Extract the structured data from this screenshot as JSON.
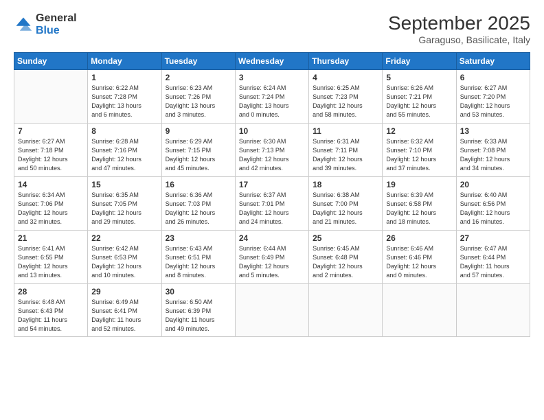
{
  "header": {
    "logo": {
      "general": "General",
      "blue": "Blue"
    },
    "title": "September 2025",
    "location": "Garaguso, Basilicate, Italy"
  },
  "weekdays": [
    "Sunday",
    "Monday",
    "Tuesday",
    "Wednesday",
    "Thursday",
    "Friday",
    "Saturday"
  ],
  "rows": [
    [
      {
        "day": "",
        "info": ""
      },
      {
        "day": "1",
        "info": "Sunrise: 6:22 AM\nSunset: 7:28 PM\nDaylight: 13 hours\nand 6 minutes."
      },
      {
        "day": "2",
        "info": "Sunrise: 6:23 AM\nSunset: 7:26 PM\nDaylight: 13 hours\nand 3 minutes."
      },
      {
        "day": "3",
        "info": "Sunrise: 6:24 AM\nSunset: 7:24 PM\nDaylight: 13 hours\nand 0 minutes."
      },
      {
        "day": "4",
        "info": "Sunrise: 6:25 AM\nSunset: 7:23 PM\nDaylight: 12 hours\nand 58 minutes."
      },
      {
        "day": "5",
        "info": "Sunrise: 6:26 AM\nSunset: 7:21 PM\nDaylight: 12 hours\nand 55 minutes."
      },
      {
        "day": "6",
        "info": "Sunrise: 6:27 AM\nSunset: 7:20 PM\nDaylight: 12 hours\nand 53 minutes."
      }
    ],
    [
      {
        "day": "7",
        "info": "Sunrise: 6:27 AM\nSunset: 7:18 PM\nDaylight: 12 hours\nand 50 minutes."
      },
      {
        "day": "8",
        "info": "Sunrise: 6:28 AM\nSunset: 7:16 PM\nDaylight: 12 hours\nand 47 minutes."
      },
      {
        "day": "9",
        "info": "Sunrise: 6:29 AM\nSunset: 7:15 PM\nDaylight: 12 hours\nand 45 minutes."
      },
      {
        "day": "10",
        "info": "Sunrise: 6:30 AM\nSunset: 7:13 PM\nDaylight: 12 hours\nand 42 minutes."
      },
      {
        "day": "11",
        "info": "Sunrise: 6:31 AM\nSunset: 7:11 PM\nDaylight: 12 hours\nand 39 minutes."
      },
      {
        "day": "12",
        "info": "Sunrise: 6:32 AM\nSunset: 7:10 PM\nDaylight: 12 hours\nand 37 minutes."
      },
      {
        "day": "13",
        "info": "Sunrise: 6:33 AM\nSunset: 7:08 PM\nDaylight: 12 hours\nand 34 minutes."
      }
    ],
    [
      {
        "day": "14",
        "info": "Sunrise: 6:34 AM\nSunset: 7:06 PM\nDaylight: 12 hours\nand 32 minutes."
      },
      {
        "day": "15",
        "info": "Sunrise: 6:35 AM\nSunset: 7:05 PM\nDaylight: 12 hours\nand 29 minutes."
      },
      {
        "day": "16",
        "info": "Sunrise: 6:36 AM\nSunset: 7:03 PM\nDaylight: 12 hours\nand 26 minutes."
      },
      {
        "day": "17",
        "info": "Sunrise: 6:37 AM\nSunset: 7:01 PM\nDaylight: 12 hours\nand 24 minutes."
      },
      {
        "day": "18",
        "info": "Sunrise: 6:38 AM\nSunset: 7:00 PM\nDaylight: 12 hours\nand 21 minutes."
      },
      {
        "day": "19",
        "info": "Sunrise: 6:39 AM\nSunset: 6:58 PM\nDaylight: 12 hours\nand 18 minutes."
      },
      {
        "day": "20",
        "info": "Sunrise: 6:40 AM\nSunset: 6:56 PM\nDaylight: 12 hours\nand 16 minutes."
      }
    ],
    [
      {
        "day": "21",
        "info": "Sunrise: 6:41 AM\nSunset: 6:55 PM\nDaylight: 12 hours\nand 13 minutes."
      },
      {
        "day": "22",
        "info": "Sunrise: 6:42 AM\nSunset: 6:53 PM\nDaylight: 12 hours\nand 10 minutes."
      },
      {
        "day": "23",
        "info": "Sunrise: 6:43 AM\nSunset: 6:51 PM\nDaylight: 12 hours\nand 8 minutes."
      },
      {
        "day": "24",
        "info": "Sunrise: 6:44 AM\nSunset: 6:49 PM\nDaylight: 12 hours\nand 5 minutes."
      },
      {
        "day": "25",
        "info": "Sunrise: 6:45 AM\nSunset: 6:48 PM\nDaylight: 12 hours\nand 2 minutes."
      },
      {
        "day": "26",
        "info": "Sunrise: 6:46 AM\nSunset: 6:46 PM\nDaylight: 12 hours\nand 0 minutes."
      },
      {
        "day": "27",
        "info": "Sunrise: 6:47 AM\nSunset: 6:44 PM\nDaylight: 11 hours\nand 57 minutes."
      }
    ],
    [
      {
        "day": "28",
        "info": "Sunrise: 6:48 AM\nSunset: 6:43 PM\nDaylight: 11 hours\nand 54 minutes."
      },
      {
        "day": "29",
        "info": "Sunrise: 6:49 AM\nSunset: 6:41 PM\nDaylight: 11 hours\nand 52 minutes."
      },
      {
        "day": "30",
        "info": "Sunrise: 6:50 AM\nSunset: 6:39 PM\nDaylight: 11 hours\nand 49 minutes."
      },
      {
        "day": "",
        "info": ""
      },
      {
        "day": "",
        "info": ""
      },
      {
        "day": "",
        "info": ""
      },
      {
        "day": "",
        "info": ""
      }
    ]
  ]
}
